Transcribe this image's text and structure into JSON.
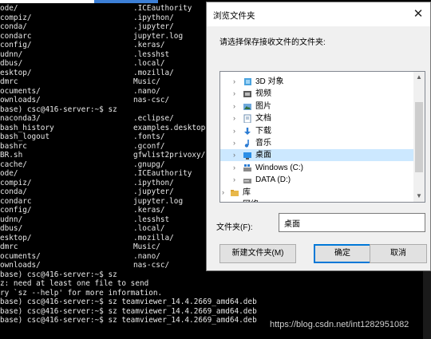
{
  "terminal": {
    "lines": [
      [
        "ode/",
        ".ICEauthority"
      ],
      [
        "compiz/",
        ".ipython/"
      ],
      [
        "conda/",
        ".jupyter/"
      ],
      [
        "condarc",
        "jupyter.log"
      ],
      [
        "config/",
        ".keras/"
      ],
      [
        "udnn/",
        ".lesshst"
      ],
      [
        "dbus/",
        ".local/"
      ],
      [
        "esktop/",
        ".mozilla/"
      ],
      [
        "dmrc",
        "Music/"
      ],
      [
        "ocuments/",
        ".nano/"
      ],
      [
        "ownloads/",
        "nas-csc/"
      ],
      [
        "base) csc@416-server:~$ sz",
        ""
      ],
      [
        "naconda3/",
        ".eclipse/"
      ],
      [
        "bash_history",
        "examples.desktop"
      ],
      [
        "bash_logout",
        ".fonts/"
      ],
      [
        "bashrc",
        ".gconf/"
      ],
      [
        "BR.sh",
        "gfwlist2privoxy/"
      ],
      [
        "cache/",
        ".gnupg/"
      ],
      [
        "ode/",
        ".ICEauthority"
      ],
      [
        "compiz/",
        ".ipython/"
      ],
      [
        "conda/",
        ".jupyter/"
      ],
      [
        "condarc",
        "jupyter.log"
      ],
      [
        "config/",
        ".keras/"
      ],
      [
        "udnn/",
        ".lesshst"
      ],
      [
        "dbus/",
        ".local/"
      ],
      [
        "esktop/",
        ".mozilla/"
      ],
      [
        "dmrc",
        "Music/"
      ],
      [
        "ocuments/",
        ".nano/"
      ],
      [
        "ownloads/",
        "nas-csc/"
      ],
      [
        "base) csc@416-server:~$ sz",
        ""
      ],
      [
        "z: need at least one file to send",
        ""
      ],
      [
        "ry `sz --help' for more information.",
        ""
      ],
      [
        "base) csc@416-server:~$ sz teamviewer_14.4.2669_amd64.deb",
        ""
      ],
      [
        "base) csc@416-server:~$ sz teamviewer_14.4.2669_amd64.deb",
        ""
      ],
      [
        "base) csc@416-server:~$ sz teamviewer_14.4.2669_amd64.deb",
        ""
      ]
    ]
  },
  "watermark": "https://blog.csdn.net/int1282951082",
  "dialog": {
    "title": "浏览文件夹",
    "close_glyph": "✕",
    "prompt": "请选择保存接收文件的文件夹:",
    "tree": [
      {
        "label": "3D 对象",
        "icon": "3d-objects-icon",
        "name": "tree-item-3d-objects"
      },
      {
        "label": "视频",
        "icon": "video-icon",
        "name": "tree-item-videos"
      },
      {
        "label": "图片",
        "icon": "pictures-icon",
        "name": "tree-item-pictures"
      },
      {
        "label": "文档",
        "icon": "document-icon",
        "name": "tree-item-documents"
      },
      {
        "label": "下载",
        "icon": "download-icon",
        "name": "tree-item-downloads"
      },
      {
        "label": "音乐",
        "icon": "music-icon",
        "name": "tree-item-music"
      },
      {
        "label": "桌面",
        "icon": "desktop-icon",
        "name": "tree-item-desktop",
        "selected": true
      },
      {
        "label": "Windows (C:)",
        "icon": "windows-drive-icon",
        "name": "tree-item-drive-c"
      },
      {
        "label": "DATA (D:)",
        "icon": "drive-icon",
        "name": "tree-item-drive-d"
      },
      {
        "label": "库",
        "icon": "library-icon",
        "name": "tree-item-libraries"
      },
      {
        "label": "网络",
        "icon": "network-icon",
        "name": "tree-item-network"
      }
    ],
    "folder_label": "文件夹(F):",
    "folder_value": "桌面",
    "buttons": {
      "new_folder": "新建文件夹(M)",
      "ok": "确定",
      "cancel": "取消"
    },
    "colors": {
      "selection": "#cce8ff",
      "accent": "#0078d7"
    }
  }
}
